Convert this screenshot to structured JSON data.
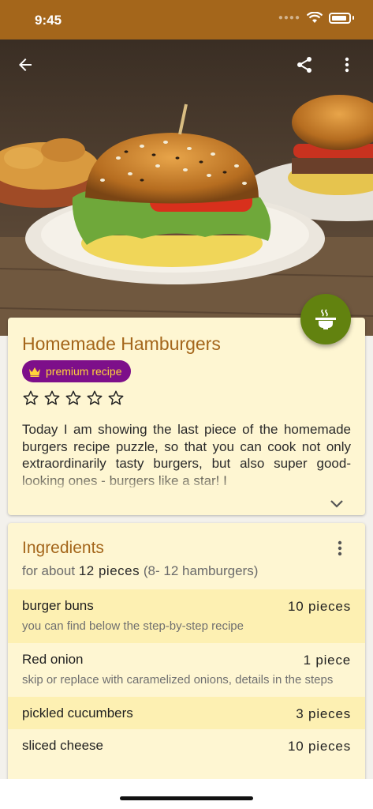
{
  "status_bar": {
    "time": "9:45"
  },
  "hero": {
    "back_icon": "arrow-left-icon",
    "share_icon": "share-icon",
    "more_icon": "more-vertical-icon"
  },
  "fab": {
    "icon": "cooking-pot-icon",
    "color": "#62820f"
  },
  "recipe": {
    "title": "Homemade Hamburgers",
    "badge_label": "premium recipe",
    "badge_icon": "crown-icon",
    "rating_max": 5,
    "rating": 0,
    "description": "Today I am showing the last piece of the homemade burgers recipe puzzle, so that you can cook not only extraordinarily tasty burgers, but also super good-looking ones - burgers like a star! I"
  },
  "ingredients": {
    "title": "Ingredients",
    "subtitle_prefix": "for about",
    "subtitle_amount": "12 pieces",
    "subtitle_suffix": "(8- 12 hamburgers)",
    "items": [
      {
        "name": "burger buns",
        "quantity": "10 pieces",
        "note": "you can find below the step-by-step recipe"
      },
      {
        "name": "Red onion",
        "quantity": "1 piece",
        "note": "skip or replace with caramelized onions, details in the steps"
      },
      {
        "name": "pickled cucumbers",
        "quantity": "3 pieces",
        "note": ""
      },
      {
        "name": "sliced cheese",
        "quantity": "10 pieces",
        "note": ""
      }
    ]
  },
  "colors": {
    "brand": "#a4661b",
    "card_background": "#fef6d2",
    "highlight_row": "#fdf0b2",
    "premium_badge": "#7d0f8a",
    "premium_text": "#ffd43b"
  }
}
